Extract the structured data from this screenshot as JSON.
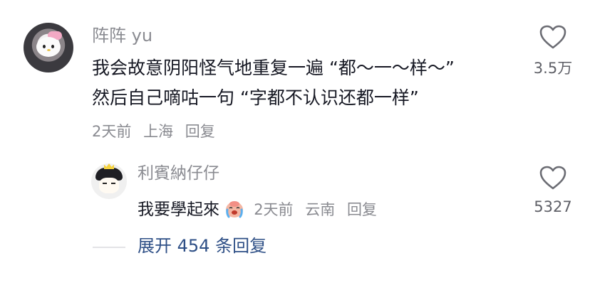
{
  "comment": {
    "username": "阵阵 yu",
    "lines": [
      "我会故意阴阳怪气地重复一遍 “都～一～样～”",
      "然后自己嘀咕一句 “字都不认识还都一样”"
    ],
    "time": "2天前",
    "location": "上海",
    "reply_label": "回复",
    "like_count": "3.5万",
    "icons": {
      "like": "heart-icon",
      "avatar": "hello-kitty-avatar"
    }
  },
  "reply": {
    "username": "利賓納仔仔",
    "text": "我要學起來",
    "emoji": "crying-face-emoji",
    "time": "2天前",
    "location": "云南",
    "reply_label": "回复",
    "like_count": "5327",
    "icons": {
      "like": "heart-icon",
      "avatar": "cartoon-girl-crown-avatar"
    }
  },
  "expand": {
    "label": "展开 454 条回复"
  },
  "colors": {
    "text_primary": "#161823",
    "text_secondary": "#8a8b91",
    "link": "#2e4f86",
    "divider": "#e3e3e6"
  }
}
